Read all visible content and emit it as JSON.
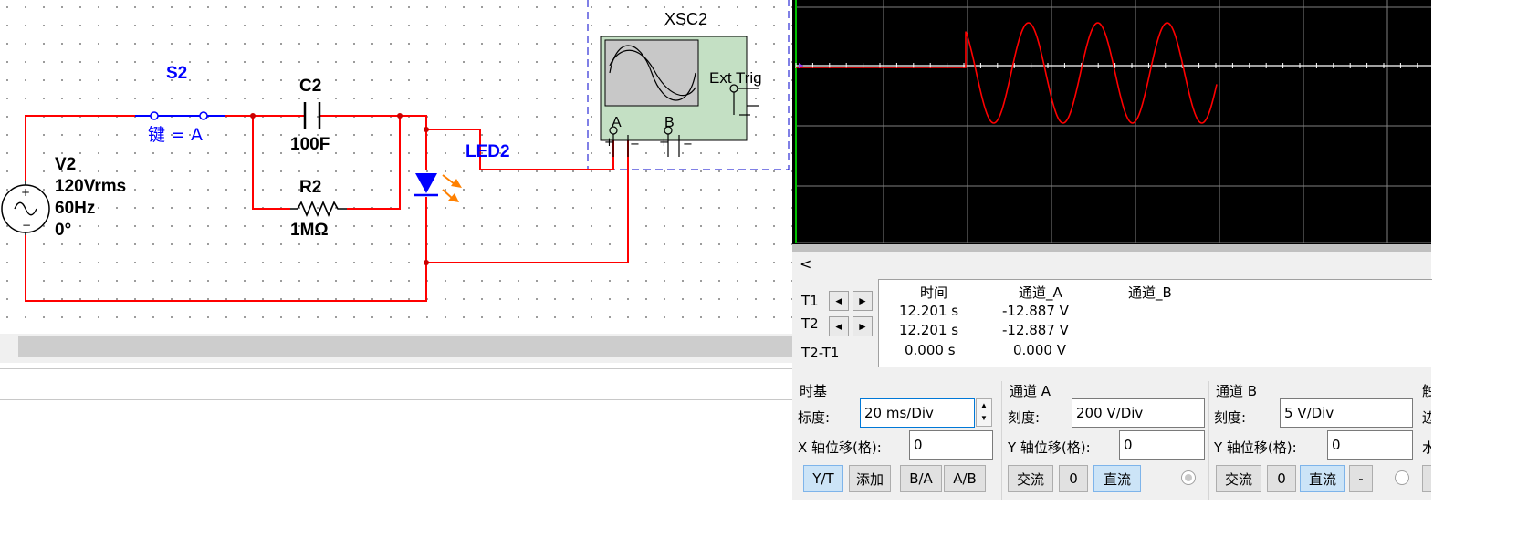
{
  "schematic": {
    "switch": {
      "name": "S2",
      "key": "键 = A"
    },
    "capacitor": {
      "name": "C2",
      "value": "100F"
    },
    "resistor": {
      "name": "R2",
      "value": "1MΩ"
    },
    "source": {
      "name": "V2",
      "voltage": "120Vrms",
      "freq": "60Hz",
      "phase": "0°"
    },
    "led": {
      "name": "LED2"
    },
    "scope": {
      "name": "XSC2",
      "ext_trig": "Ext Trig",
      "ch_a": "A",
      "ch_b": "B"
    }
  },
  "colors": {
    "wire": "#ff0000",
    "component_label": "#0000ff",
    "trace": "#ff0000",
    "grid": "#808080",
    "scope_body": "#c4e0c4"
  },
  "scope_panel": {
    "scroll_left": "<",
    "cursors": {
      "t1": "T1",
      "t2": "T2",
      "diff": "T2-T1"
    },
    "readout": {
      "headers": [
        "时间",
        "通道_A",
        "通道_B"
      ],
      "rows": [
        {
          "time": "12.201 s",
          "a": "-12.887 V",
          "b": ""
        },
        {
          "time": "12.201 s",
          "a": "-12.887 V",
          "b": ""
        },
        {
          "time": "0.000 s",
          "a": "0.000 V",
          "b": ""
        }
      ]
    },
    "timebase": {
      "title": "时基",
      "scale_label": "标度:",
      "scale_value": "20 ms/Div",
      "xpos_label": "X 轴位移(格):",
      "xpos_value": "0",
      "buttons": [
        "Y/T",
        "添加",
        "B/A",
        "A/B"
      ]
    },
    "channel_a": {
      "title": "通道 A",
      "scale_label": "刻度:",
      "scale_value": "200  V/Div",
      "ypos_label": "Y 轴位移(格):",
      "ypos_value": "0",
      "buttons": [
        "交流",
        "0",
        "直流"
      ]
    },
    "channel_b": {
      "title": "通道 B",
      "scale_label": "刻度:",
      "scale_value": "5  V/Div",
      "ypos_label": "Y 轴位移(格):",
      "ypos_value": "0",
      "buttons": [
        "交流",
        "0",
        "直流",
        "-"
      ]
    },
    "trigger": {
      "title_partial": "触",
      "edge_partial": "边",
      "level_partial": "水"
    }
  }
}
